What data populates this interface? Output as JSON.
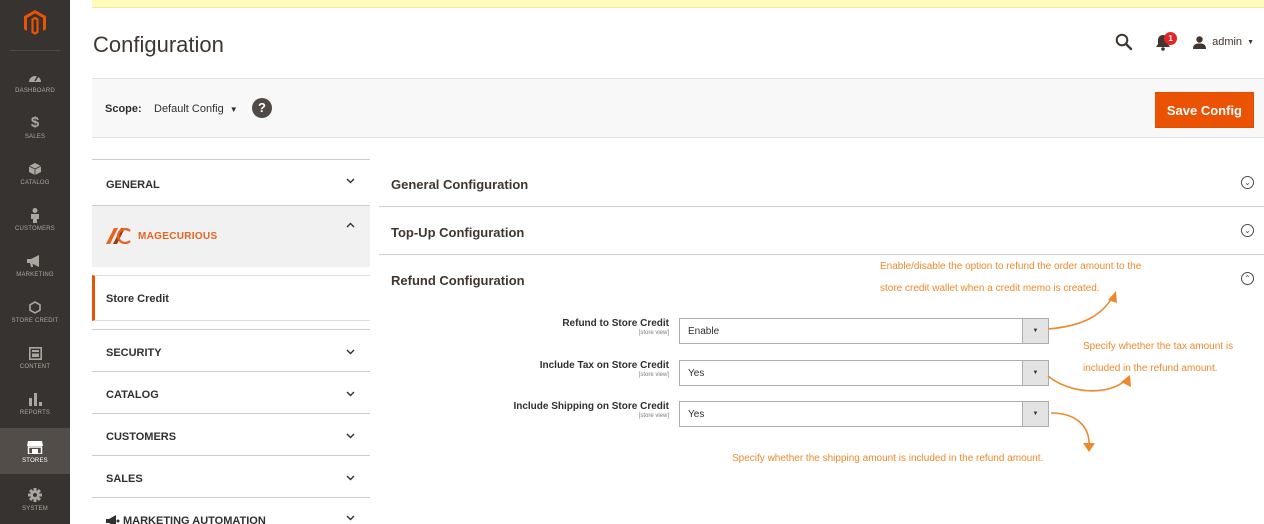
{
  "sidebar": {
    "items": [
      {
        "label": "DASHBOARD",
        "icon": "dashboard-icon"
      },
      {
        "label": "SALES",
        "icon": "dollar-icon"
      },
      {
        "label": "CATALOG",
        "icon": "cube-icon"
      },
      {
        "label": "CUSTOMERS",
        "icon": "person-icon"
      },
      {
        "label": "MARKETING",
        "icon": "megaphone-icon"
      },
      {
        "label": "STORE CREDIT",
        "icon": "hexagon-icon"
      },
      {
        "label": "CONTENT",
        "icon": "layout-icon"
      },
      {
        "label": "REPORTS",
        "icon": "bar-chart-icon"
      },
      {
        "label": "STORES",
        "icon": "store-icon"
      },
      {
        "label": "SYSTEM",
        "icon": "gear-icon"
      }
    ],
    "active": "STORES",
    "accent": "#eb5202"
  },
  "header": {
    "title": "Configuration",
    "notifications_count": "1",
    "user": "admin"
  },
  "scope": {
    "label": "Scope:",
    "value": "Default Config",
    "help": "?",
    "save_label": "Save Config"
  },
  "config_nav": {
    "general": "GENERAL",
    "brand": "MAGECURIOUS",
    "store_credit": "Store Credit",
    "sections": [
      "SECURITY",
      "CATALOG",
      "CUSTOMERS",
      "SALES",
      "MARKETING AUTOMATION"
    ]
  },
  "config_main": {
    "sections": [
      "General Configuration",
      "Top-Up Configuration",
      "Refund Configuration"
    ],
    "fields": [
      {
        "label": "Refund to Store Credit",
        "scope": "[store view]",
        "value": "Enable"
      },
      {
        "label": "Include Tax on Store Credit",
        "scope": "[store view]",
        "value": "Yes"
      },
      {
        "label": "Include Shipping on Store Credit",
        "scope": "[store view]",
        "value": "Yes"
      }
    ]
  },
  "annotations": {
    "refund_line1": "Enable/disable the option to refund the order amount to the",
    "refund_line2": "store credit wallet when a credit memo is created.",
    "tax_line1": "Specify whether the tax amount is",
    "tax_line2": "included in the refund amount.",
    "shipping": "Specify whether the shipping amount is included in the refund amount.",
    "color": "#eb8a2d"
  }
}
